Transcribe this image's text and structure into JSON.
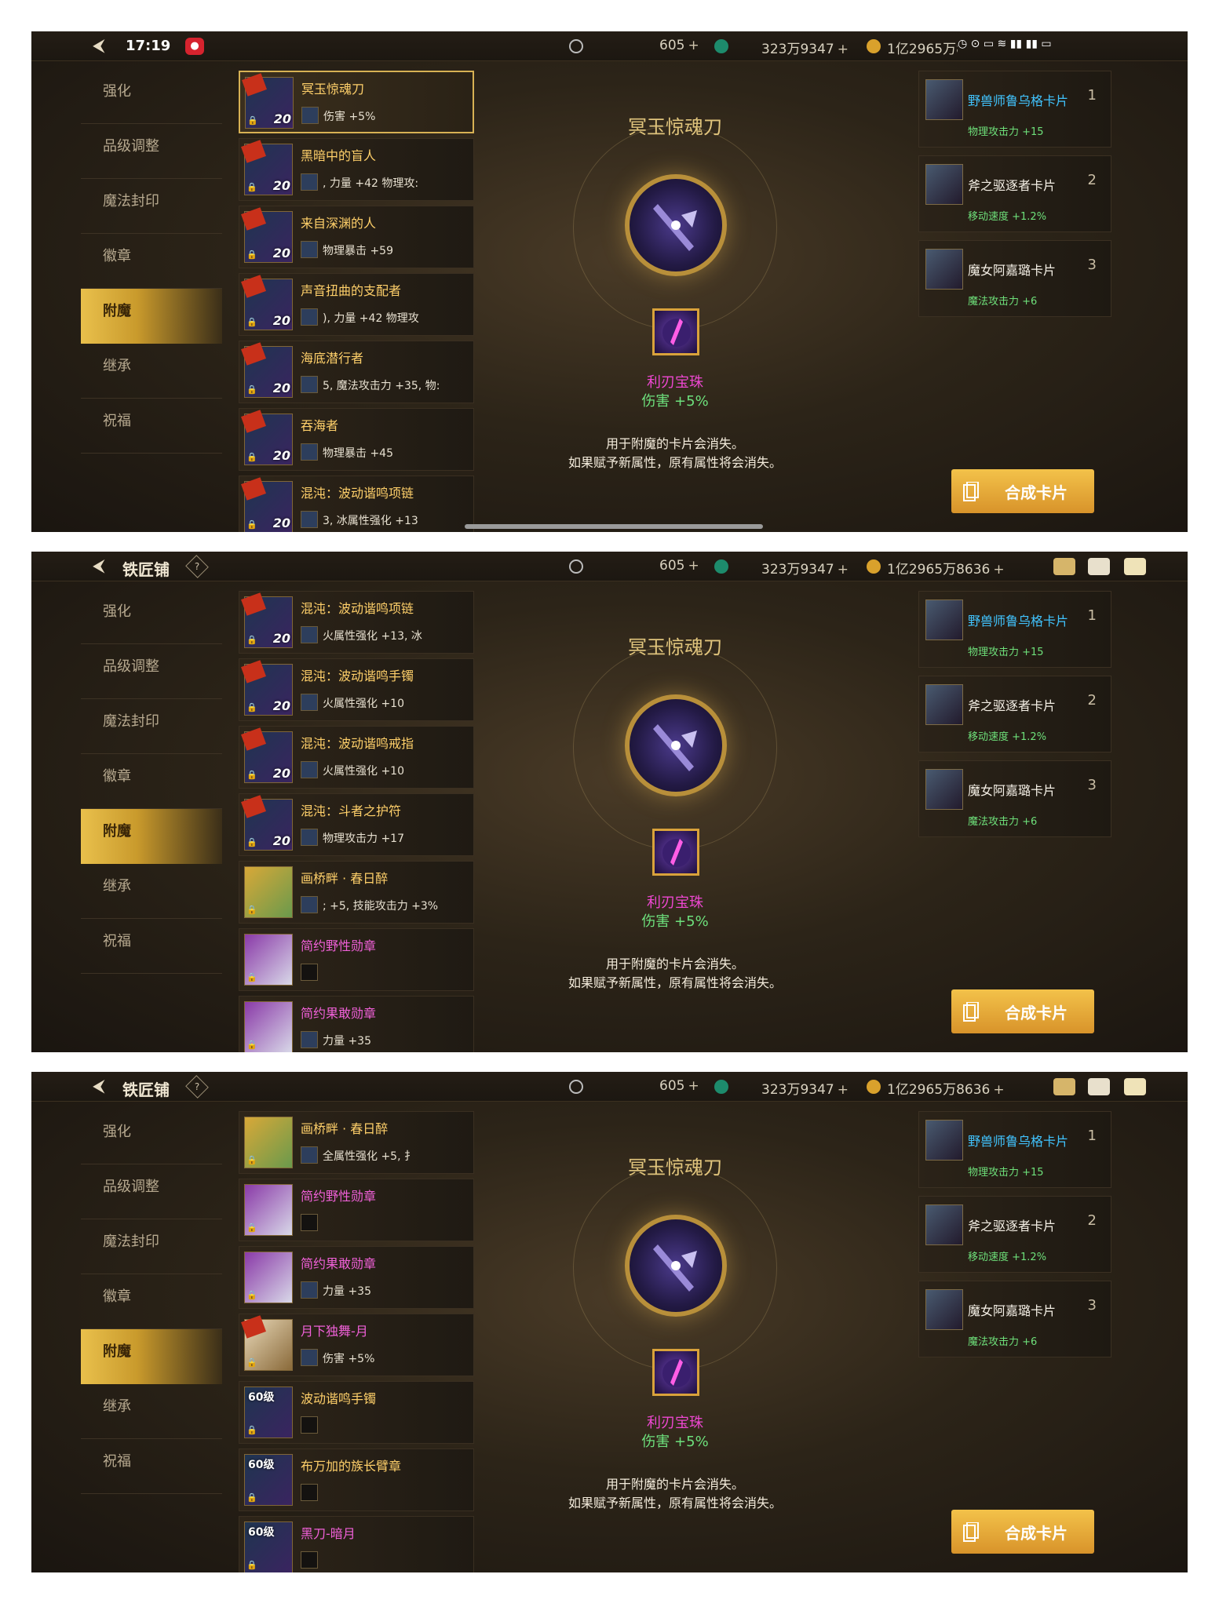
{
  "header": {
    "title": "铁匠铺",
    "clock": "17:19",
    "diamond": "605",
    "gold_gems": "323万9347",
    "coins": "1亿2965万8636"
  },
  "sidebar": [
    "强化",
    "品级调整",
    "魔法封印",
    "徽章",
    "附魔",
    "继承",
    "祝福"
  ],
  "active_tab": "附魔",
  "item": {
    "title": "冥玉惊魂刀",
    "gem_name": "利刃宝珠",
    "gem_stat": "伤害 +5%"
  },
  "note": [
    "用于附魔的卡片会消失。",
    "如果赋予新属性，原有属性将会消失。"
  ],
  "cards": [
    {
      "name": "野兽师鲁乌格卡片",
      "num": "1",
      "stat": "物理攻击力 +15"
    },
    {
      "name": "斧之驱逐者卡片",
      "num": "2",
      "stat": "移动速度 +1.2%"
    },
    {
      "name": "魔女阿嘉璐卡片",
      "num": "3",
      "stat": "魔法攻击力 +6"
    }
  ],
  "synth_label": "合成卡片",
  "lists": [
    [
      {
        "name": "冥玉惊魂刀",
        "lvl": "20",
        "stat": "伤害 +5%"
      },
      {
        "name": "黑暗中的盲人",
        "lvl": "20",
        "stat": ", 力量 +42     物理攻:"
      },
      {
        "name": "来自深渊的人",
        "lvl": "20",
        "stat": "物理暴击 +59"
      },
      {
        "name": "声音扭曲的支配者",
        "lvl": "20",
        "stat": "), 力量 +42     物理攻"
      },
      {
        "name": "海底潜行者",
        "lvl": "20",
        "stat": "5, 魔法攻击力 +35, 物:"
      },
      {
        "name": "吞海者",
        "lvl": "20",
        "stat": "物理暴击 +45"
      },
      {
        "name": "混沌：波动谐鸣项链",
        "lvl": "20",
        "stat": "3, 冰属性强化 +13"
      }
    ],
    [
      {
        "name": "混沌：波动谐鸣项链",
        "lvl": "20",
        "stat": "火属性强化 +13, 冰"
      },
      {
        "name": "混沌：波动谐鸣手镯",
        "lvl": "20",
        "stat": "火属性强化 +10"
      },
      {
        "name": "混沌：波动谐鸣戒指",
        "lvl": "20",
        "stat": "火属性强化 +10"
      },
      {
        "name": "混沌：斗者之护符",
        "lvl": "20",
        "stat": "物理攻击力 +17"
      },
      {
        "name": "画桥畔 · 春日醉",
        "lvl": "",
        "stat": "; +5, 技能攻击力 +3%"
      },
      {
        "name": "简约野性勋章",
        "lvl": "",
        "stat": ""
      },
      {
        "name": "简约果敢勋章",
        "lvl": "",
        "stat": "力量 +35"
      }
    ],
    [
      {
        "name": "画桥畔 · 春日醉",
        "lvl": "",
        "stat": "全属性强化 +5, 扌"
      },
      {
        "name": "简约野性勋章",
        "lvl": "",
        "stat": ""
      },
      {
        "name": "简约果敢勋章",
        "lvl": "",
        "stat": "力量 +35"
      },
      {
        "name": "月下独舞-月",
        "lvl": "",
        "stat": "伤害 +5%"
      },
      {
        "name": "波动谐鸣手镯",
        "lvl": "60级",
        "stat": ""
      },
      {
        "name": "布万加的族长臂章",
        "lvl": "60级",
        "stat": ""
      },
      {
        "name": "黑刀-暗月",
        "lvl": "60级",
        "stat": ""
      }
    ]
  ]
}
